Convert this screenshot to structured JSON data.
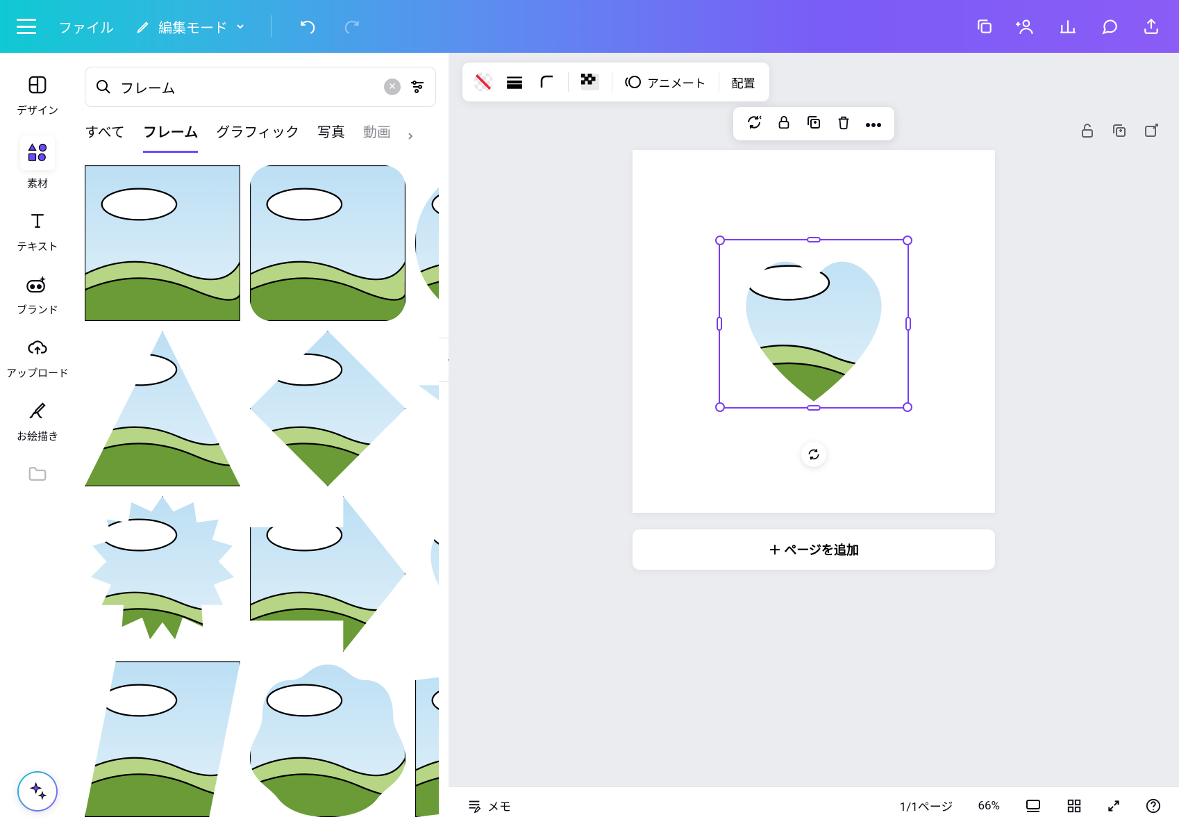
{
  "topbar": {
    "file_label": "ファイル",
    "edit_mode_label": "編集モード"
  },
  "rail": {
    "design": "デザイン",
    "elements": "素材",
    "text": "テキスト",
    "brand": "ブランド",
    "upload": "アップロード",
    "draw": "お絵描き"
  },
  "panel": {
    "search_value": "フレーム",
    "tabs": {
      "all": "すべて",
      "frames": "フレーム",
      "graphics": "グラフィック",
      "photos": "写真",
      "videos": "動画"
    }
  },
  "context": {
    "animate": "アニメート",
    "position": "配置"
  },
  "canvas": {
    "add_page": "＋ ページを追加"
  },
  "footer": {
    "notes": "メモ",
    "page_counter": "1/1ページ",
    "zoom": "66%"
  }
}
